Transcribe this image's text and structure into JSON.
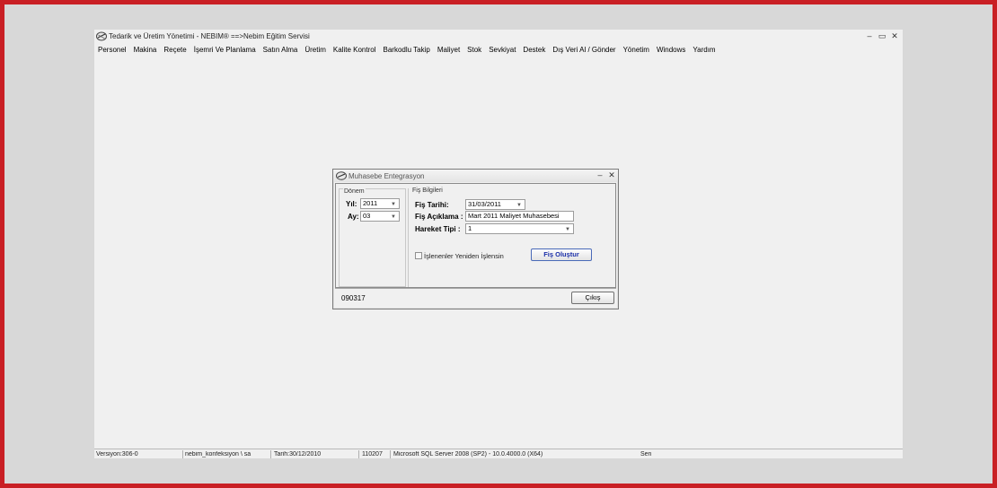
{
  "app": {
    "title": "Tedarik ve Üretim Yönetimi - NEBIM® ==>Nebim Eğitim Servisi",
    "controls": {
      "minimize": "–",
      "restore": "▭",
      "close": "✕"
    }
  },
  "menu": [
    "Personel",
    "Makina",
    "Reçete",
    "İşemri Ve Planlama",
    "Satın Alma",
    "Üretim",
    "Kalite Kontrol",
    "Barkodlu Takip",
    "Maliyet",
    "Stok",
    "Sevkiyat",
    "Destek",
    "Dış Veri Al / Gönder",
    "Yönetim",
    "Windows",
    "Yardım"
  ],
  "status": {
    "version": "Versiyon:306-0",
    "connection": "nebim_konfeksiyon \\ sa",
    "date": "Tarih:30/12/2010",
    "code": "110207",
    "server": "Microsoft SQL Server 2008 (SP2) - 10.0.4000.0 (X64)",
    "user": "Sen"
  },
  "dialog": {
    "title": "Muhasebe Entegrasyon",
    "controls": {
      "minimize": "–",
      "close": "✕"
    },
    "period_group": {
      "label": "Dönem",
      "year_label": "Yıl:",
      "year_value": "2011",
      "month_label": "Ay:",
      "month_value": "03"
    },
    "slip_group": {
      "label": "Fiş Bilgileri",
      "date_label": "Fiş Tarihi:",
      "date_value": "31/03/2011",
      "desc_label": "Fiş Açıklama :",
      "desc_value": "Mart 2011 Maliyet Muhasebesi",
      "type_label": "Hareket Tipi :",
      "type_value": "1",
      "reprocess_label": "İşlenenler Yeniden İşlensin",
      "create_button": "Fiş Oluştur"
    },
    "footer": {
      "code": "090317",
      "exit_button": "Çıkış"
    }
  },
  "colors": {
    "frame": "#c91f24",
    "backdrop": "#d8d8d8",
    "window": "#f0f0f0",
    "primary_button_text": "#1a2ea8"
  }
}
